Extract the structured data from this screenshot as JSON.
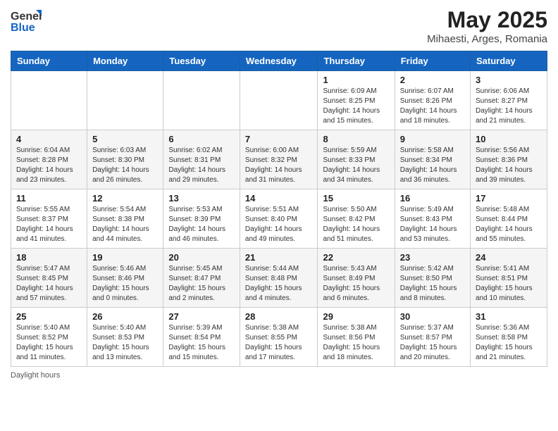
{
  "header": {
    "logo_general": "General",
    "logo_blue": "Blue",
    "month_title": "May 2025",
    "subtitle": "Mihaesti, Arges, Romania"
  },
  "weekdays": [
    "Sunday",
    "Monday",
    "Tuesday",
    "Wednesday",
    "Thursday",
    "Friday",
    "Saturday"
  ],
  "weeks": [
    [
      {
        "day": "",
        "info": ""
      },
      {
        "day": "",
        "info": ""
      },
      {
        "day": "",
        "info": ""
      },
      {
        "day": "",
        "info": ""
      },
      {
        "day": "1",
        "info": "Sunrise: 6:09 AM\nSunset: 8:25 PM\nDaylight: 14 hours\nand 15 minutes."
      },
      {
        "day": "2",
        "info": "Sunrise: 6:07 AM\nSunset: 8:26 PM\nDaylight: 14 hours\nand 18 minutes."
      },
      {
        "day": "3",
        "info": "Sunrise: 6:06 AM\nSunset: 8:27 PM\nDaylight: 14 hours\nand 21 minutes."
      }
    ],
    [
      {
        "day": "4",
        "info": "Sunrise: 6:04 AM\nSunset: 8:28 PM\nDaylight: 14 hours\nand 23 minutes."
      },
      {
        "day": "5",
        "info": "Sunrise: 6:03 AM\nSunset: 8:30 PM\nDaylight: 14 hours\nand 26 minutes."
      },
      {
        "day": "6",
        "info": "Sunrise: 6:02 AM\nSunset: 8:31 PM\nDaylight: 14 hours\nand 29 minutes."
      },
      {
        "day": "7",
        "info": "Sunrise: 6:00 AM\nSunset: 8:32 PM\nDaylight: 14 hours\nand 31 minutes."
      },
      {
        "day": "8",
        "info": "Sunrise: 5:59 AM\nSunset: 8:33 PM\nDaylight: 14 hours\nand 34 minutes."
      },
      {
        "day": "9",
        "info": "Sunrise: 5:58 AM\nSunset: 8:34 PM\nDaylight: 14 hours\nand 36 minutes."
      },
      {
        "day": "10",
        "info": "Sunrise: 5:56 AM\nSunset: 8:36 PM\nDaylight: 14 hours\nand 39 minutes."
      }
    ],
    [
      {
        "day": "11",
        "info": "Sunrise: 5:55 AM\nSunset: 8:37 PM\nDaylight: 14 hours\nand 41 minutes."
      },
      {
        "day": "12",
        "info": "Sunrise: 5:54 AM\nSunset: 8:38 PM\nDaylight: 14 hours\nand 44 minutes."
      },
      {
        "day": "13",
        "info": "Sunrise: 5:53 AM\nSunset: 8:39 PM\nDaylight: 14 hours\nand 46 minutes."
      },
      {
        "day": "14",
        "info": "Sunrise: 5:51 AM\nSunset: 8:40 PM\nDaylight: 14 hours\nand 49 minutes."
      },
      {
        "day": "15",
        "info": "Sunrise: 5:50 AM\nSunset: 8:42 PM\nDaylight: 14 hours\nand 51 minutes."
      },
      {
        "day": "16",
        "info": "Sunrise: 5:49 AM\nSunset: 8:43 PM\nDaylight: 14 hours\nand 53 minutes."
      },
      {
        "day": "17",
        "info": "Sunrise: 5:48 AM\nSunset: 8:44 PM\nDaylight: 14 hours\nand 55 minutes."
      }
    ],
    [
      {
        "day": "18",
        "info": "Sunrise: 5:47 AM\nSunset: 8:45 PM\nDaylight: 14 hours\nand 57 minutes."
      },
      {
        "day": "19",
        "info": "Sunrise: 5:46 AM\nSunset: 8:46 PM\nDaylight: 15 hours\nand 0 minutes."
      },
      {
        "day": "20",
        "info": "Sunrise: 5:45 AM\nSunset: 8:47 PM\nDaylight: 15 hours\nand 2 minutes."
      },
      {
        "day": "21",
        "info": "Sunrise: 5:44 AM\nSunset: 8:48 PM\nDaylight: 15 hours\nand 4 minutes."
      },
      {
        "day": "22",
        "info": "Sunrise: 5:43 AM\nSunset: 8:49 PM\nDaylight: 15 hours\nand 6 minutes."
      },
      {
        "day": "23",
        "info": "Sunrise: 5:42 AM\nSunset: 8:50 PM\nDaylight: 15 hours\nand 8 minutes."
      },
      {
        "day": "24",
        "info": "Sunrise: 5:41 AM\nSunset: 8:51 PM\nDaylight: 15 hours\nand 10 minutes."
      }
    ],
    [
      {
        "day": "25",
        "info": "Sunrise: 5:40 AM\nSunset: 8:52 PM\nDaylight: 15 hours\nand 11 minutes."
      },
      {
        "day": "26",
        "info": "Sunrise: 5:40 AM\nSunset: 8:53 PM\nDaylight: 15 hours\nand 13 minutes."
      },
      {
        "day": "27",
        "info": "Sunrise: 5:39 AM\nSunset: 8:54 PM\nDaylight: 15 hours\nand 15 minutes."
      },
      {
        "day": "28",
        "info": "Sunrise: 5:38 AM\nSunset: 8:55 PM\nDaylight: 15 hours\nand 17 minutes."
      },
      {
        "day": "29",
        "info": "Sunrise: 5:38 AM\nSunset: 8:56 PM\nDaylight: 15 hours\nand 18 minutes."
      },
      {
        "day": "30",
        "info": "Sunrise: 5:37 AM\nSunset: 8:57 PM\nDaylight: 15 hours\nand 20 minutes."
      },
      {
        "day": "31",
        "info": "Sunrise: 5:36 AM\nSunset: 8:58 PM\nDaylight: 15 hours\nand 21 minutes."
      }
    ]
  ],
  "footer": {
    "daylight_label": "Daylight hours"
  }
}
